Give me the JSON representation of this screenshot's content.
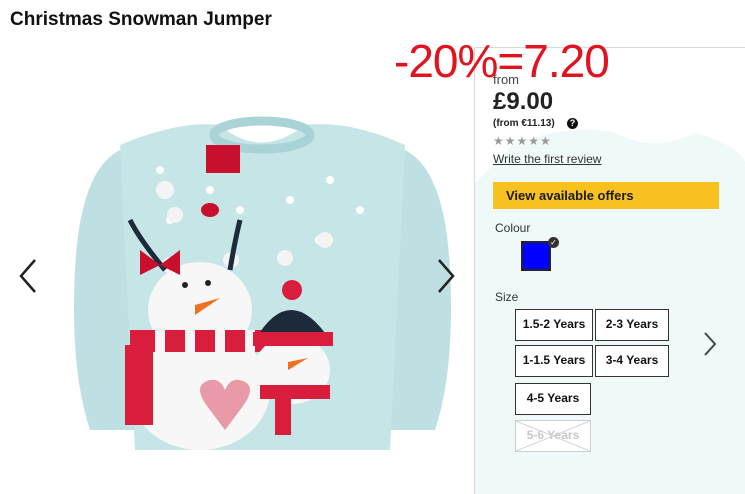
{
  "product": {
    "title": "Christmas Snowman Jumper"
  },
  "gallery": {
    "prev_icon": "chevron-left-icon",
    "next_icon": "chevron-right-icon"
  },
  "pricing": {
    "from_label": "from",
    "price": "£9.00",
    "alt_price": "(from €11.13)",
    "help_icon": "?",
    "rating_stars": "★★★★★",
    "review_link": "Write the first review"
  },
  "offers": {
    "button_label": "View available offers",
    "color": "#f7c21f"
  },
  "colour": {
    "label": "Colour",
    "selected_color": "#0000ff"
  },
  "size": {
    "label": "Size",
    "options": [
      {
        "label": "1.5-2 Years",
        "available": true
      },
      {
        "label": "2-3 Years",
        "available": true
      },
      {
        "label": "1-1.5 Years",
        "available": true
      },
      {
        "label": "3-4 Years",
        "available": true
      },
      {
        "label": "4-5 Years",
        "available": true
      },
      {
        "label": "5-6 Years",
        "available": false
      }
    ]
  },
  "overlay": {
    "text": "-20%=7.20",
    "color": "#e0141e"
  }
}
